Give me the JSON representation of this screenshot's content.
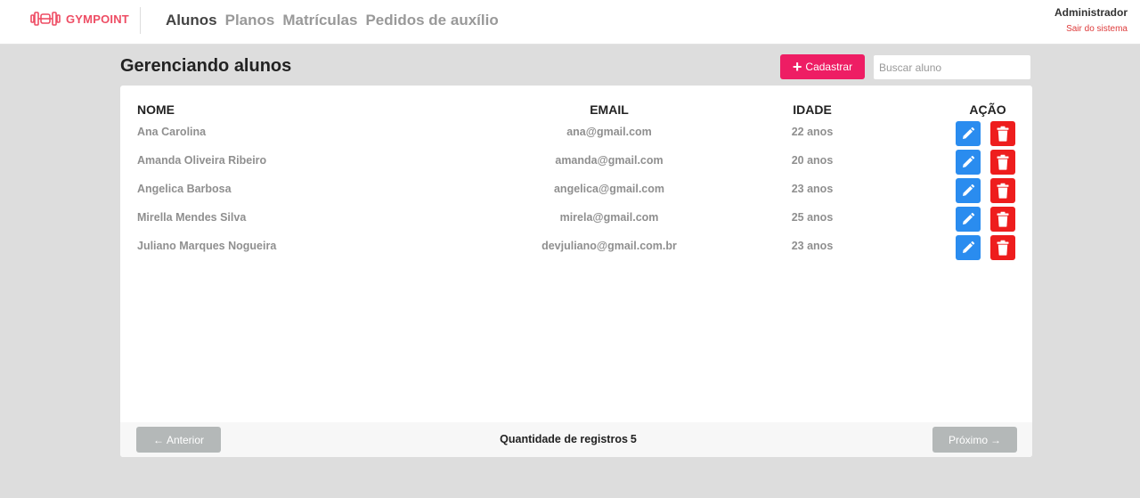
{
  "header": {
    "brand": "GYMPOINT",
    "nav": [
      {
        "label": "Alunos",
        "active": true
      },
      {
        "label": "Planos",
        "active": false
      },
      {
        "label": "Matrículas",
        "active": false
      },
      {
        "label": "Pedidos de auxílio",
        "active": false
      }
    ],
    "user_name": "Administrador",
    "logout_label": "Sair do sistema"
  },
  "toolbar": {
    "title": "Gerenciando alunos",
    "add_label": "Cadastrar",
    "search_placeholder": "Buscar aluno"
  },
  "table": {
    "columns": {
      "name": "NOME",
      "email": "EMAIL",
      "age": "IDADE",
      "action": "AÇÃO"
    },
    "rows": [
      {
        "name": "Ana Carolina",
        "email": "ana@gmail.com",
        "age": "22 anos"
      },
      {
        "name": "Amanda Oliveira Ribeiro",
        "email": "amanda@gmail.com",
        "age": "20 anos"
      },
      {
        "name": "Angelica Barbosa",
        "email": "angelica@gmail.com",
        "age": "23 anos"
      },
      {
        "name": "Mirella Mendes Silva",
        "email": "mirela@gmail.com",
        "age": "25 anos"
      },
      {
        "name": "Juliano Marques Nogueira",
        "email": "devjuliano@gmail.com.br",
        "age": "23 anos"
      }
    ]
  },
  "pagination": {
    "prev_label": "Anterior",
    "next_label": "Próximo",
    "count_label": "Quantidade de registros",
    "count_value": "5"
  },
  "icons": {
    "brand": "dumbbell-icon",
    "add": "plus-icon",
    "edit": "pencil-icon",
    "delete": "trash-icon",
    "prev": "arrow-left-icon",
    "next": "arrow-right-icon"
  },
  "colors": {
    "brand": "#ee4d64",
    "primary_button": "#ee1d64",
    "edit_button": "#2a8cef",
    "delete_button": "#ee1d1d",
    "disabled_button": "#b4b8b8",
    "logout_link": "#de3b3b"
  }
}
